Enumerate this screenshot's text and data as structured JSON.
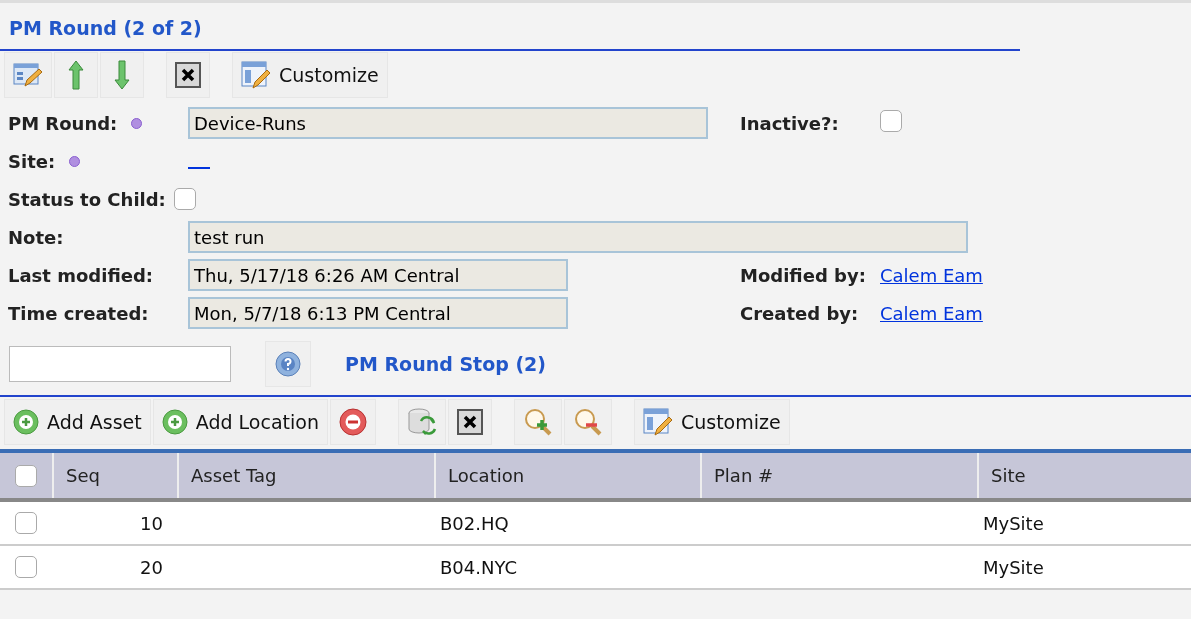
{
  "title": "PM Round (2 of 2)",
  "toolbar": [
    {
      "kind": "edit"
    },
    {
      "kind": "up"
    },
    {
      "kind": "down"
    },
    {
      "kind": "close"
    },
    {
      "kind": "customize",
      "label": "Customize"
    }
  ],
  "form": {
    "pm_round": {
      "label": "PM Round:",
      "required": true,
      "value": "Device-Runs"
    },
    "inactive": {
      "label": "Inactive?:",
      "checked": false
    },
    "site": {
      "label": "Site:",
      "required": true
    },
    "status_to_child": {
      "label": "Status to Child:",
      "checked": false
    },
    "note": {
      "label": "Note:",
      "value": "test run"
    },
    "last_modified": {
      "label": "Last modified:",
      "value": "Thu, 5/17/18 6:26 AM Central"
    },
    "modified_by": {
      "label": "Modified by:",
      "value": "Calem Eam"
    },
    "time_created": {
      "label": "Time created:",
      "value": "Mon, 5/7/18 6:13 PM Central"
    },
    "created_by": {
      "label": "Created by:",
      "value": "Calem Eam"
    }
  },
  "section_title": "PM Round Stop (2)",
  "grid_toolbar": [
    {
      "kind": "add",
      "label": "Add Asset"
    },
    {
      "kind": "add",
      "label": "Add Location"
    },
    {
      "kind": "remove"
    },
    {
      "kind": "refresh"
    },
    {
      "kind": "close"
    },
    {
      "kind": "zoomin"
    },
    {
      "kind": "zoomout"
    },
    {
      "kind": "customize",
      "label": "Customize"
    }
  ],
  "table": {
    "select_all": false,
    "columns": [
      "Seq",
      "Asset Tag",
      "Location",
      "Plan #",
      "Site"
    ],
    "rows": [
      {
        "selected": false,
        "cells": [
          "10",
          "",
          "B02.HQ",
          "",
          "MySite"
        ]
      },
      {
        "selected": false,
        "cells": [
          "20",
          "",
          "B04.NYC",
          "",
          "MySite"
        ]
      }
    ]
  }
}
